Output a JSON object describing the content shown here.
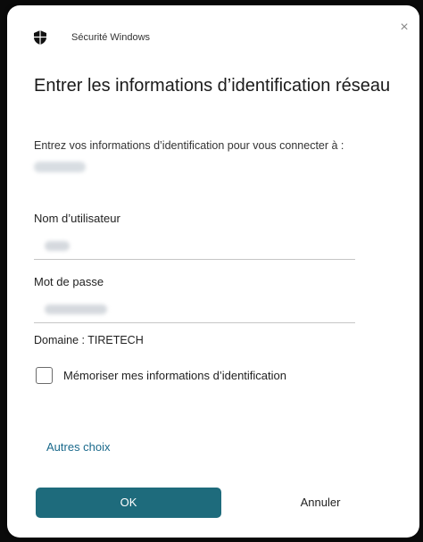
{
  "window": {
    "app_title": "Sécurité Windows",
    "close_glyph": "×"
  },
  "heading": "Entrer les informations d’identification réseau",
  "subtext": "Entrez vos informations d’identification pour vous connecter à :",
  "fields": {
    "username_label": "Nom d’utilisateur",
    "password_label": "Mot de passe"
  },
  "domain_text": "Domaine : TIRETECH",
  "remember": {
    "label": "Mémoriser mes informations d’identification",
    "checked": false
  },
  "more_choices": "Autres choix",
  "buttons": {
    "ok": "OK",
    "cancel": "Annuler"
  },
  "colors": {
    "accent": "#1e6b7c",
    "link": "#1b6a8c"
  },
  "icons": {
    "app": "shield-icon",
    "close": "close-icon"
  }
}
